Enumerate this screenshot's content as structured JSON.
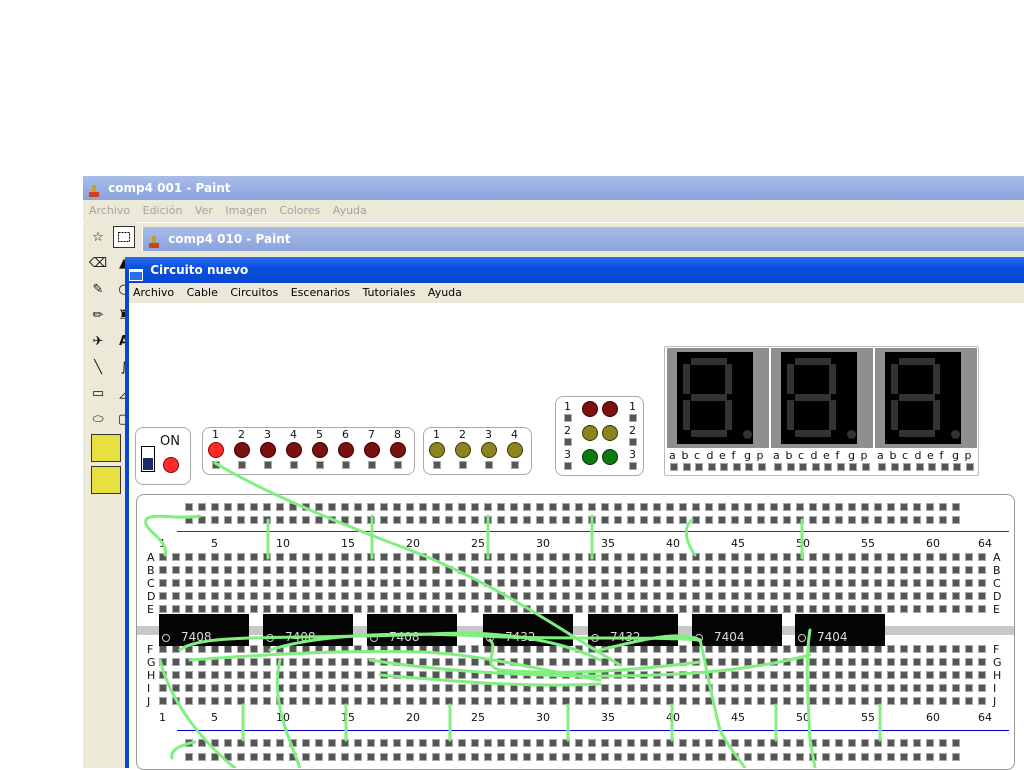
{
  "paint1": {
    "title": "comp4 001 - Paint",
    "menu": [
      "Archivo",
      "Edición",
      "Ver",
      "Imagen",
      "Colores",
      "Ayuda"
    ]
  },
  "paint2": {
    "title": "comp4 010 - Paint"
  },
  "app": {
    "title": "Circuito nuevo",
    "menu": [
      "Archivo",
      "Cable",
      "Circuitos",
      "Escenarios",
      "Tutoriales",
      "Ayuda"
    ]
  },
  "power": {
    "label": "ON"
  },
  "leds_red": {
    "labels": [
      "1",
      "2",
      "3",
      "4",
      "5",
      "6",
      "7",
      "8"
    ],
    "on": [
      true,
      false,
      false,
      false,
      false,
      false,
      false,
      false
    ]
  },
  "leds_yellow": {
    "labels": [
      "1",
      "2",
      "3",
      "4"
    ]
  },
  "traffic": {
    "labels": [
      "1",
      "2",
      "3"
    ]
  },
  "seven_seg": {
    "pin_labels": [
      "a",
      "b",
      "c",
      "d",
      "e",
      "f",
      "g",
      "p"
    ],
    "digits": 3
  },
  "breadboard": {
    "column_numbers": [
      "1",
      "5",
      "10",
      "15",
      "20",
      "25",
      "30",
      "35",
      "40",
      "45",
      "50",
      "55",
      "60",
      "64"
    ],
    "rows_top": [
      "A",
      "B",
      "C",
      "D",
      "E"
    ],
    "rows_bottom": [
      "F",
      "G",
      "H",
      "I",
      "J"
    ],
    "chips": [
      "7408",
      "7408",
      "7408",
      "7432",
      "7432",
      "7404",
      "7404"
    ]
  },
  "colors": {
    "wire": "#80ef80",
    "chip": "#050505",
    "titlebar": "#0a4fe0",
    "led_red": "#7a1010",
    "led_on": "#ff2a2a"
  }
}
